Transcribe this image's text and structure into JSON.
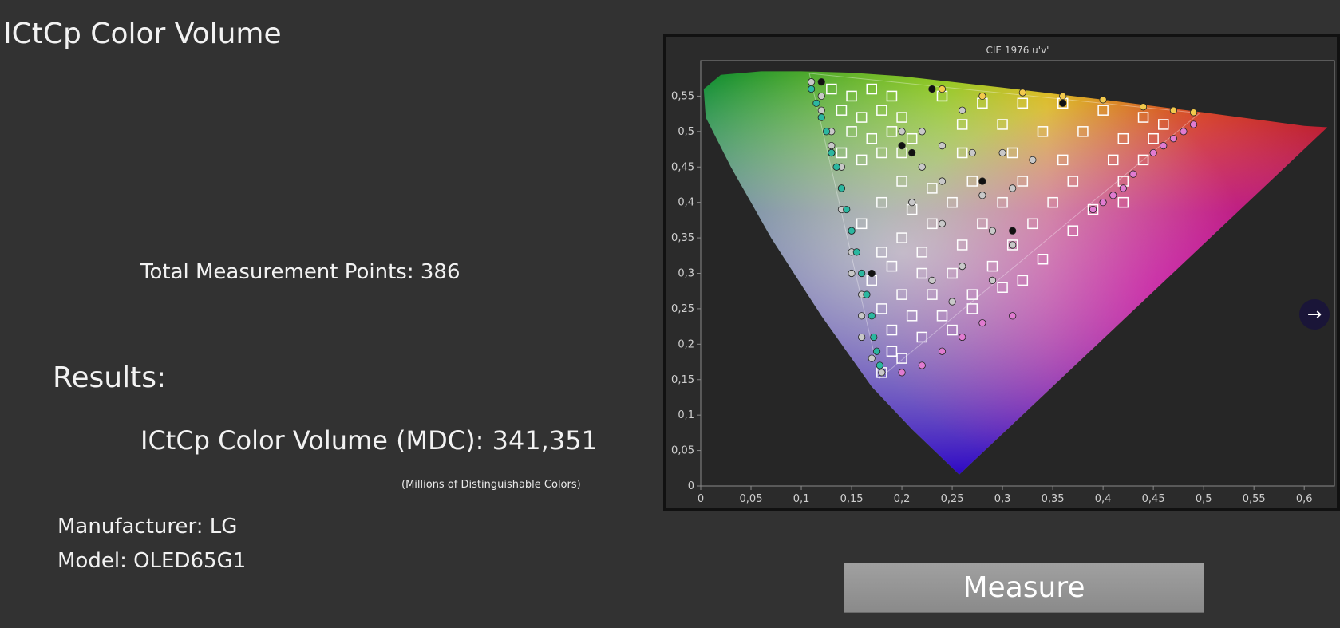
{
  "page": {
    "title": "ICtCp Color Volume",
    "total_points": "Total Measurement Points: 386",
    "results_heading": "Results:",
    "mdc_value": "ICtCp Color Volume (MDC): 341,351",
    "mdc_unit": "(Millions of Distinguishable  Colors)",
    "manufacturer": "Manufacturer: LG",
    "model": "Model: OLED65G1",
    "measure_label": "Measure",
    "next_icon": "arrow-right-icon"
  },
  "chart_data": {
    "type": "scatter",
    "title": "CIE 1976 u'v'",
    "xlim": [
      0,
      0.63
    ],
    "ylim": [
      0,
      0.6
    ],
    "x_ticks": [
      "0",
      "0,05",
      "0,1",
      "0,15",
      "0,2",
      "0,25",
      "0,3",
      "0,35",
      "0,4",
      "0,45",
      "0,5",
      "0,55",
      "0,6"
    ],
    "y_ticks": [
      "0",
      "0,05",
      "0,1",
      "0,15",
      "0,2",
      "0,25",
      "0,3",
      "0,35",
      "0,4",
      "0,45",
      "0,5",
      "0,55"
    ],
    "grid": false,
    "spectral_locus": [
      [
        0.257,
        0.016
      ],
      [
        0.21,
        0.08
      ],
      [
        0.17,
        0.14
      ],
      [
        0.12,
        0.24
      ],
      [
        0.07,
        0.35
      ],
      [
        0.03,
        0.45
      ],
      [
        0.005,
        0.52
      ],
      [
        0.003,
        0.56
      ],
      [
        0.02,
        0.58
      ],
      [
        0.06,
        0.585
      ],
      [
        0.1,
        0.585
      ],
      [
        0.15,
        0.583
      ],
      [
        0.2,
        0.578
      ],
      [
        0.3,
        0.562
      ],
      [
        0.4,
        0.545
      ],
      [
        0.5,
        0.527
      ],
      [
        0.6,
        0.508
      ],
      [
        0.623,
        0.506
      ]
    ],
    "gamut_triangle": [
      [
        0.108,
        0.582
      ],
      [
        0.496,
        0.526
      ],
      [
        0.178,
        0.152
      ]
    ],
    "series": [
      {
        "marker": "square",
        "color": "#ffffff",
        "points": [
          [
            0.13,
            0.56
          ],
          [
            0.15,
            0.55
          ],
          [
            0.17,
            0.56
          ],
          [
            0.19,
            0.55
          ],
          [
            0.14,
            0.53
          ],
          [
            0.16,
            0.52
          ],
          [
            0.18,
            0.53
          ],
          [
            0.2,
            0.52
          ],
          [
            0.15,
            0.5
          ],
          [
            0.17,
            0.49
          ],
          [
            0.19,
            0.5
          ],
          [
            0.21,
            0.49
          ],
          [
            0.14,
            0.47
          ],
          [
            0.16,
            0.46
          ],
          [
            0.18,
            0.47
          ],
          [
            0.2,
            0.47
          ],
          [
            0.24,
            0.55
          ],
          [
            0.28,
            0.54
          ],
          [
            0.32,
            0.54
          ],
          [
            0.36,
            0.54
          ],
          [
            0.4,
            0.53
          ],
          [
            0.44,
            0.52
          ],
          [
            0.46,
            0.51
          ],
          [
            0.26,
            0.51
          ],
          [
            0.3,
            0.51
          ],
          [
            0.34,
            0.5
          ],
          [
            0.38,
            0.5
          ],
          [
            0.42,
            0.49
          ],
          [
            0.45,
            0.49
          ],
          [
            0.26,
            0.47
          ],
          [
            0.31,
            0.47
          ],
          [
            0.36,
            0.46
          ],
          [
            0.41,
            0.46
          ],
          [
            0.44,
            0.46
          ],
          [
            0.27,
            0.43
          ],
          [
            0.32,
            0.43
          ],
          [
            0.37,
            0.43
          ],
          [
            0.42,
            0.43
          ],
          [
            0.2,
            0.43
          ],
          [
            0.23,
            0.42
          ],
          [
            0.25,
            0.4
          ],
          [
            0.3,
            0.4
          ],
          [
            0.35,
            0.4
          ],
          [
            0.39,
            0.39
          ],
          [
            0.42,
            0.4
          ],
          [
            0.18,
            0.4
          ],
          [
            0.21,
            0.39
          ],
          [
            0.23,
            0.37
          ],
          [
            0.28,
            0.37
          ],
          [
            0.33,
            0.37
          ],
          [
            0.37,
            0.36
          ],
          [
            0.16,
            0.37
          ],
          [
            0.2,
            0.35
          ],
          [
            0.22,
            0.33
          ],
          [
            0.26,
            0.34
          ],
          [
            0.31,
            0.34
          ],
          [
            0.34,
            0.32
          ],
          [
            0.18,
            0.33
          ],
          [
            0.19,
            0.31
          ],
          [
            0.22,
            0.3
          ],
          [
            0.25,
            0.3
          ],
          [
            0.29,
            0.31
          ],
          [
            0.32,
            0.29
          ],
          [
            0.17,
            0.29
          ],
          [
            0.2,
            0.27
          ],
          [
            0.23,
            0.27
          ],
          [
            0.27,
            0.27
          ],
          [
            0.3,
            0.28
          ],
          [
            0.18,
            0.25
          ],
          [
            0.21,
            0.24
          ],
          [
            0.24,
            0.24
          ],
          [
            0.27,
            0.25
          ],
          [
            0.19,
            0.22
          ],
          [
            0.22,
            0.21
          ],
          [
            0.25,
            0.22
          ],
          [
            0.19,
            0.19
          ],
          [
            0.2,
            0.18
          ],
          [
            0.18,
            0.16
          ]
        ]
      },
      {
        "marker": "circle",
        "color": "#c8c8c8",
        "points": [
          [
            0.11,
            0.57
          ],
          [
            0.12,
            0.55
          ],
          [
            0.12,
            0.53
          ],
          [
            0.13,
            0.5
          ],
          [
            0.13,
            0.48
          ],
          [
            0.14,
            0.45
          ],
          [
            0.14,
            0.42
          ],
          [
            0.14,
            0.39
          ],
          [
            0.15,
            0.36
          ],
          [
            0.15,
            0.33
          ],
          [
            0.15,
            0.3
          ],
          [
            0.16,
            0.27
          ],
          [
            0.16,
            0.24
          ],
          [
            0.16,
            0.21
          ],
          [
            0.17,
            0.18
          ],
          [
            0.18,
            0.16
          ],
          [
            0.2,
            0.5
          ],
          [
            0.22,
            0.5
          ],
          [
            0.24,
            0.48
          ],
          [
            0.27,
            0.47
          ],
          [
            0.3,
            0.47
          ],
          [
            0.33,
            0.46
          ],
          [
            0.26,
            0.53
          ],
          [
            0.24,
            0.43
          ],
          [
            0.28,
            0.41
          ],
          [
            0.31,
            0.42
          ],
          [
            0.22,
            0.45
          ],
          [
            0.21,
            0.4
          ],
          [
            0.24,
            0.37
          ],
          [
            0.29,
            0.36
          ],
          [
            0.31,
            0.34
          ],
          [
            0.26,
            0.31
          ],
          [
            0.29,
            0.29
          ],
          [
            0.23,
            0.29
          ],
          [
            0.25,
            0.26
          ]
        ]
      },
      {
        "marker": "circle",
        "color": "#111111",
        "points": [
          [
            0.12,
            0.57
          ],
          [
            0.13,
            0.47
          ],
          [
            0.21,
            0.47
          ],
          [
            0.23,
            0.56
          ],
          [
            0.28,
            0.43
          ],
          [
            0.31,
            0.36
          ],
          [
            0.36,
            0.54
          ],
          [
            0.17,
            0.3
          ],
          [
            0.2,
            0.48
          ]
        ]
      },
      {
        "marker": "circle",
        "color": "#f2c94c",
        "points": [
          [
            0.24,
            0.56
          ],
          [
            0.28,
            0.55
          ],
          [
            0.32,
            0.555
          ],
          [
            0.36,
            0.55
          ],
          [
            0.4,
            0.545
          ],
          [
            0.44,
            0.535
          ],
          [
            0.47,
            0.53
          ],
          [
            0.49,
            0.527
          ]
        ]
      },
      {
        "marker": "circle",
        "color": "#e07bd0",
        "points": [
          [
            0.43,
            0.44
          ],
          [
            0.42,
            0.42
          ],
          [
            0.41,
            0.41
          ],
          [
            0.4,
            0.4
          ],
          [
            0.39,
            0.39
          ],
          [
            0.45,
            0.47
          ],
          [
            0.46,
            0.48
          ],
          [
            0.47,
            0.49
          ],
          [
            0.48,
            0.5
          ],
          [
            0.49,
            0.51
          ],
          [
            0.31,
            0.24
          ],
          [
            0.28,
            0.23
          ],
          [
            0.26,
            0.21
          ],
          [
            0.24,
            0.19
          ],
          [
            0.22,
            0.17
          ],
          [
            0.2,
            0.16
          ]
        ]
      },
      {
        "marker": "circle",
        "color": "#2bb7a0",
        "points": [
          [
            0.11,
            0.56
          ],
          [
            0.115,
            0.54
          ],
          [
            0.12,
            0.52
          ],
          [
            0.125,
            0.5
          ],
          [
            0.13,
            0.47
          ],
          [
            0.135,
            0.45
          ],
          [
            0.14,
            0.42
          ],
          [
            0.145,
            0.39
          ],
          [
            0.15,
            0.36
          ],
          [
            0.155,
            0.33
          ],
          [
            0.16,
            0.3
          ],
          [
            0.165,
            0.27
          ],
          [
            0.17,
            0.24
          ],
          [
            0.172,
            0.21
          ],
          [
            0.175,
            0.19
          ],
          [
            0.178,
            0.17
          ]
        ]
      }
    ]
  }
}
